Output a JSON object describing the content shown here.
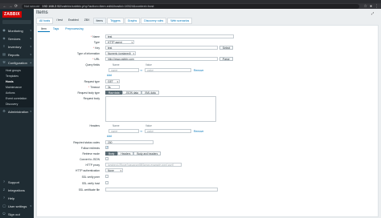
{
  "browser": {
    "security_label": "Not secure",
    "url_host": "192.168.2.52",
    "url_path": "/zabbix/zabbix.php?action=item.edit&hostid=10524&context=host",
    "back_icon": "arrow-left-icon",
    "forward_icon": "arrow-right-icon",
    "reload_icon": "reload-icon"
  },
  "sidebar": {
    "logo": "ZABBIX",
    "items": [
      {
        "label": "Monitoring",
        "icon": "eye-icon"
      },
      {
        "label": "Services",
        "icon": "services-icon"
      },
      {
        "label": "Inventory",
        "icon": "list-icon"
      },
      {
        "label": "Reports",
        "icon": "chart-icon"
      },
      {
        "label": "Configuration",
        "icon": "wrench-icon"
      }
    ],
    "config_sub": [
      "Host groups",
      "Templates",
      "Hosts",
      "Maintenance",
      "Actions",
      "Event correlation",
      "Discovery"
    ],
    "admin": "Administration",
    "bottom": [
      "Support",
      "Integrations",
      "Help",
      "User settings",
      "Sign out"
    ]
  },
  "page": {
    "title": "Items",
    "subnav": [
      "All hosts",
      "/ test",
      "Enabled",
      "ZBX",
      "Items",
      "Triggers",
      "Graphs",
      "Discovery rules",
      "Web scenarios"
    ],
    "tabs": [
      "Item",
      "Tags",
      "Preprocessing"
    ]
  },
  "form": {
    "name_label": "Name",
    "name_value": "test",
    "type_label": "Type",
    "type_value": "HTTP agent",
    "key_label": "Key",
    "key_value": "test",
    "key_button": "Select",
    "info_type_label": "Type of information",
    "info_type_value": "Numeric (unsigned)",
    "url_label": "URL",
    "url_value": "http://www.zabbix.com",
    "url_button": "Parse",
    "query_label": "Query fields",
    "col_name": "Name",
    "col_value": "Value",
    "qf_name_ph": "name",
    "qf_value_ph": "value",
    "remove": "Remove",
    "add": "Add",
    "request_type_label": "Request type",
    "request_type_value": "GET",
    "timeout_label": "Timeout",
    "timeout_value": "3s",
    "body_type_label": "Request body type",
    "body_types": [
      "Raw data",
      "JSON data",
      "XML data"
    ],
    "body_label": "Request body",
    "headers_label": "Headers",
    "status_label": "Required status codes",
    "status_value": "200",
    "follow_label": "Follow redirects",
    "retrieve_label": "Retrieve mode",
    "retrieve_modes": [
      "Body",
      "Headers",
      "Body and headers"
    ],
    "json_label": "Convert to JSON",
    "proxy_label": "HTTP proxy",
    "proxy_ph": "[protocol://][user[:password]@]proxy.example.com[:port]",
    "auth_label": "HTTP authentication",
    "auth_value": "None",
    "ssl_peer_label": "SSL verify peer",
    "ssl_host_label": "SSL verify host",
    "ssl_cert_label": "SSL certificate file"
  }
}
